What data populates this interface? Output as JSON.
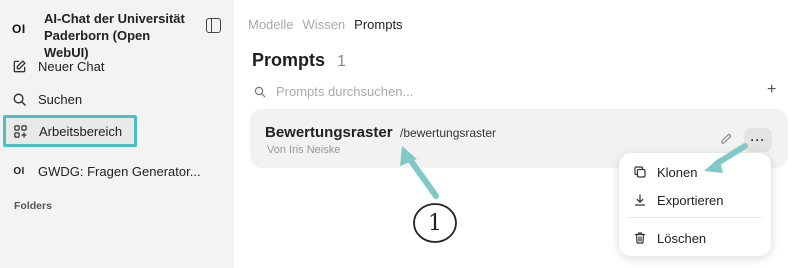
{
  "sidebar": {
    "logo": "OI",
    "title": "AI-Chat der Universität Paderborn (Open WebUI)",
    "items": [
      {
        "label": "Neuer Chat",
        "icon": "pencil-square-icon"
      },
      {
        "label": "Suchen",
        "icon": "search-icon"
      },
      {
        "label": "Arbeitsbereich",
        "icon": "workspace-icon"
      },
      {
        "label": "GWDG: Fragen Generator...",
        "icon": "oi-logo",
        "logo": "OI"
      }
    ],
    "folders_label": "Folders"
  },
  "tabs": [
    {
      "label": "Modelle",
      "active": false
    },
    {
      "label": "Wissen",
      "active": false
    },
    {
      "label": "Prompts",
      "active": true
    }
  ],
  "main": {
    "title": "Prompts",
    "count": "1",
    "search_placeholder": "Prompts durchsuchen...",
    "add_label": "+"
  },
  "prompt": {
    "title": "Bewertungsraster",
    "command": "/bewertungsraster",
    "author": "Von Iris Neiske",
    "more_label": "···"
  },
  "menu": {
    "items": [
      {
        "label": "Klonen",
        "icon": "copy-icon"
      },
      {
        "label": "Exportieren",
        "icon": "download-icon"
      },
      {
        "label": "Löschen",
        "icon": "trash-icon"
      }
    ]
  },
  "annotation": {
    "marker": "1",
    "highlight_color": "#49c1c2"
  }
}
